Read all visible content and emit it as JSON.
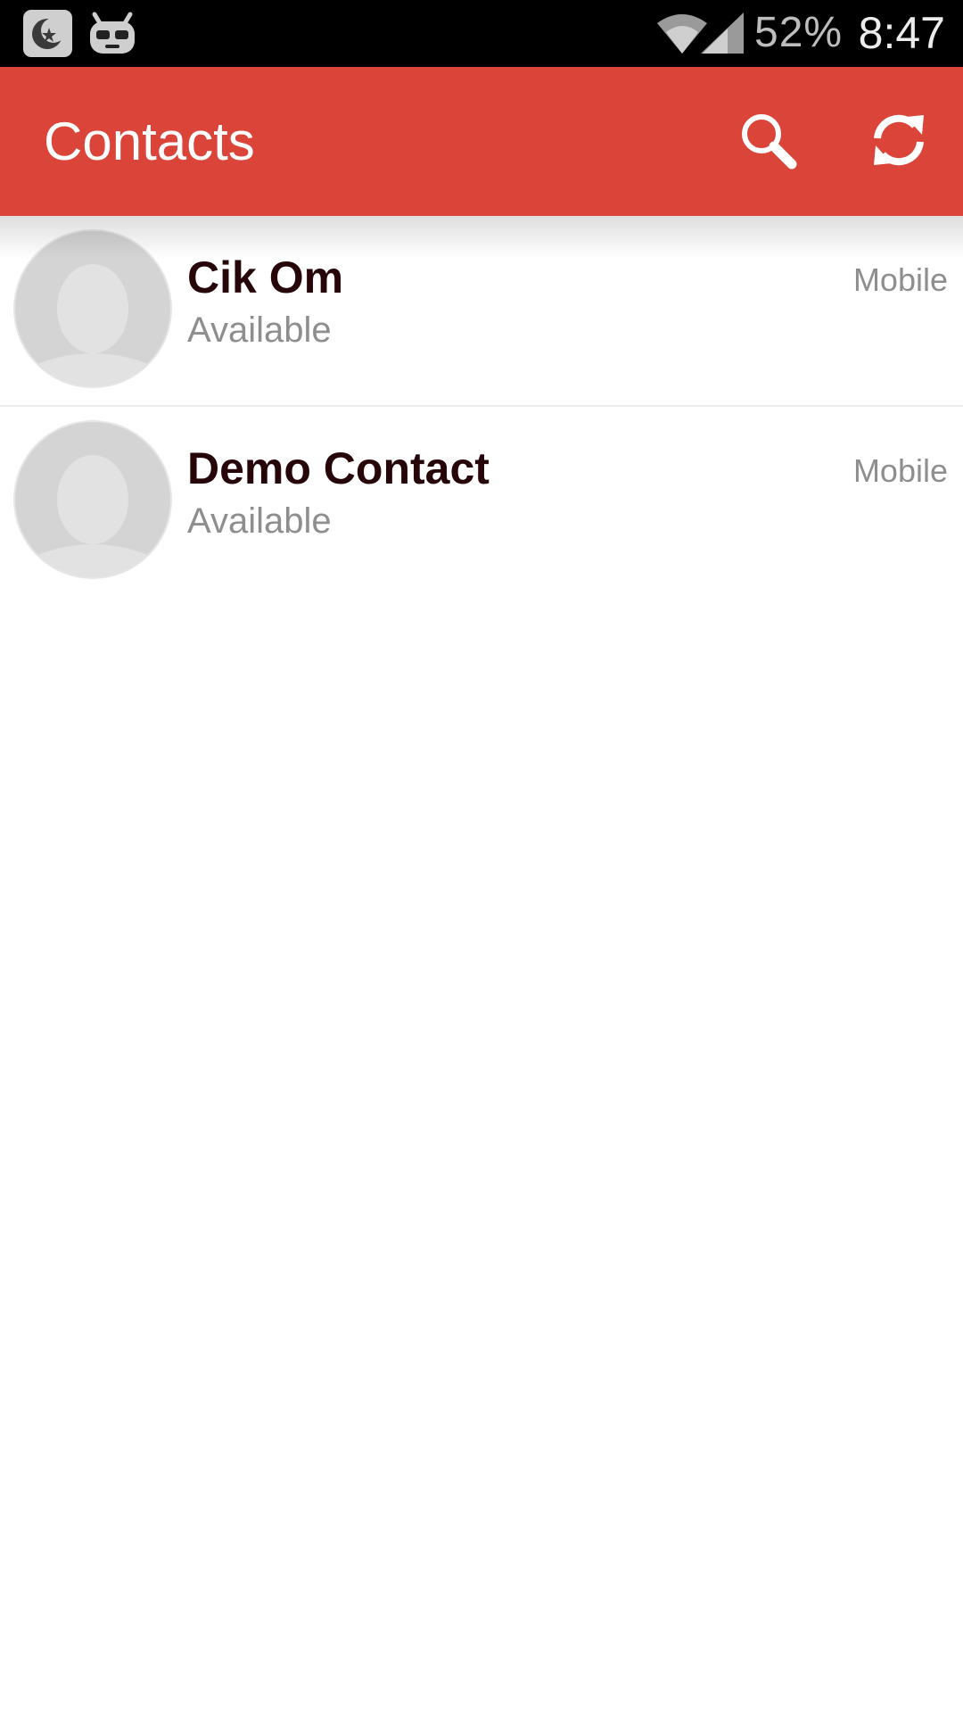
{
  "status_bar": {
    "notification_icons": [
      "cyanogen-moon-icon",
      "cid-mascot-icon"
    ],
    "wifi_icon": "wifi-icon",
    "signal_icon": "cell-signal-icon",
    "battery": "52%",
    "time": "8:47"
  },
  "app_bar": {
    "title": "Contacts",
    "actions": [
      "search-icon",
      "refresh-icon"
    ],
    "color": "#db4439"
  },
  "contacts": [
    {
      "name": "Cik Om",
      "status": "Available",
      "type": "Mobile",
      "avatar": "avatar-placeholder-icon"
    },
    {
      "name": "Demo Contact",
      "status": "Available",
      "type": "Mobile",
      "avatar": "avatar-placeholder-icon"
    }
  ],
  "colors": {
    "accent": "#db4439",
    "name_text": "#260608",
    "secondary_text": "#8e8e8e"
  }
}
